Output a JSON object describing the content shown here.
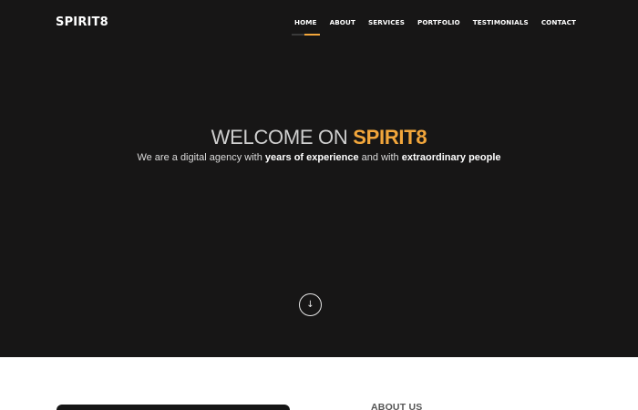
{
  "header": {
    "brand": "SPIRIT8",
    "nav": [
      {
        "label": "HOME",
        "active": true
      },
      {
        "label": "ABOUT",
        "active": false
      },
      {
        "label": "SERVICES",
        "active": false
      },
      {
        "label": "PORTFOLIO",
        "active": false
      },
      {
        "label": "TESTIMONIALS",
        "active": false
      },
      {
        "label": "CONTACT",
        "active": false
      }
    ]
  },
  "hero": {
    "title_prefix": "WELCOME ON ",
    "title_accent": "SPIRIT8",
    "subtitle_part1": "We are a digital agency with ",
    "subtitle_bold1": "years of experience",
    "subtitle_part2": " and with ",
    "subtitle_bold2": "extraordinary people",
    "scroll_icon": "arrow-down-icon"
  },
  "about": {
    "heading": "ABOUT US"
  },
  "colors": {
    "hero_bg": "#171616",
    "accent": "#f2a63b",
    "text_light": "#ffffff"
  }
}
